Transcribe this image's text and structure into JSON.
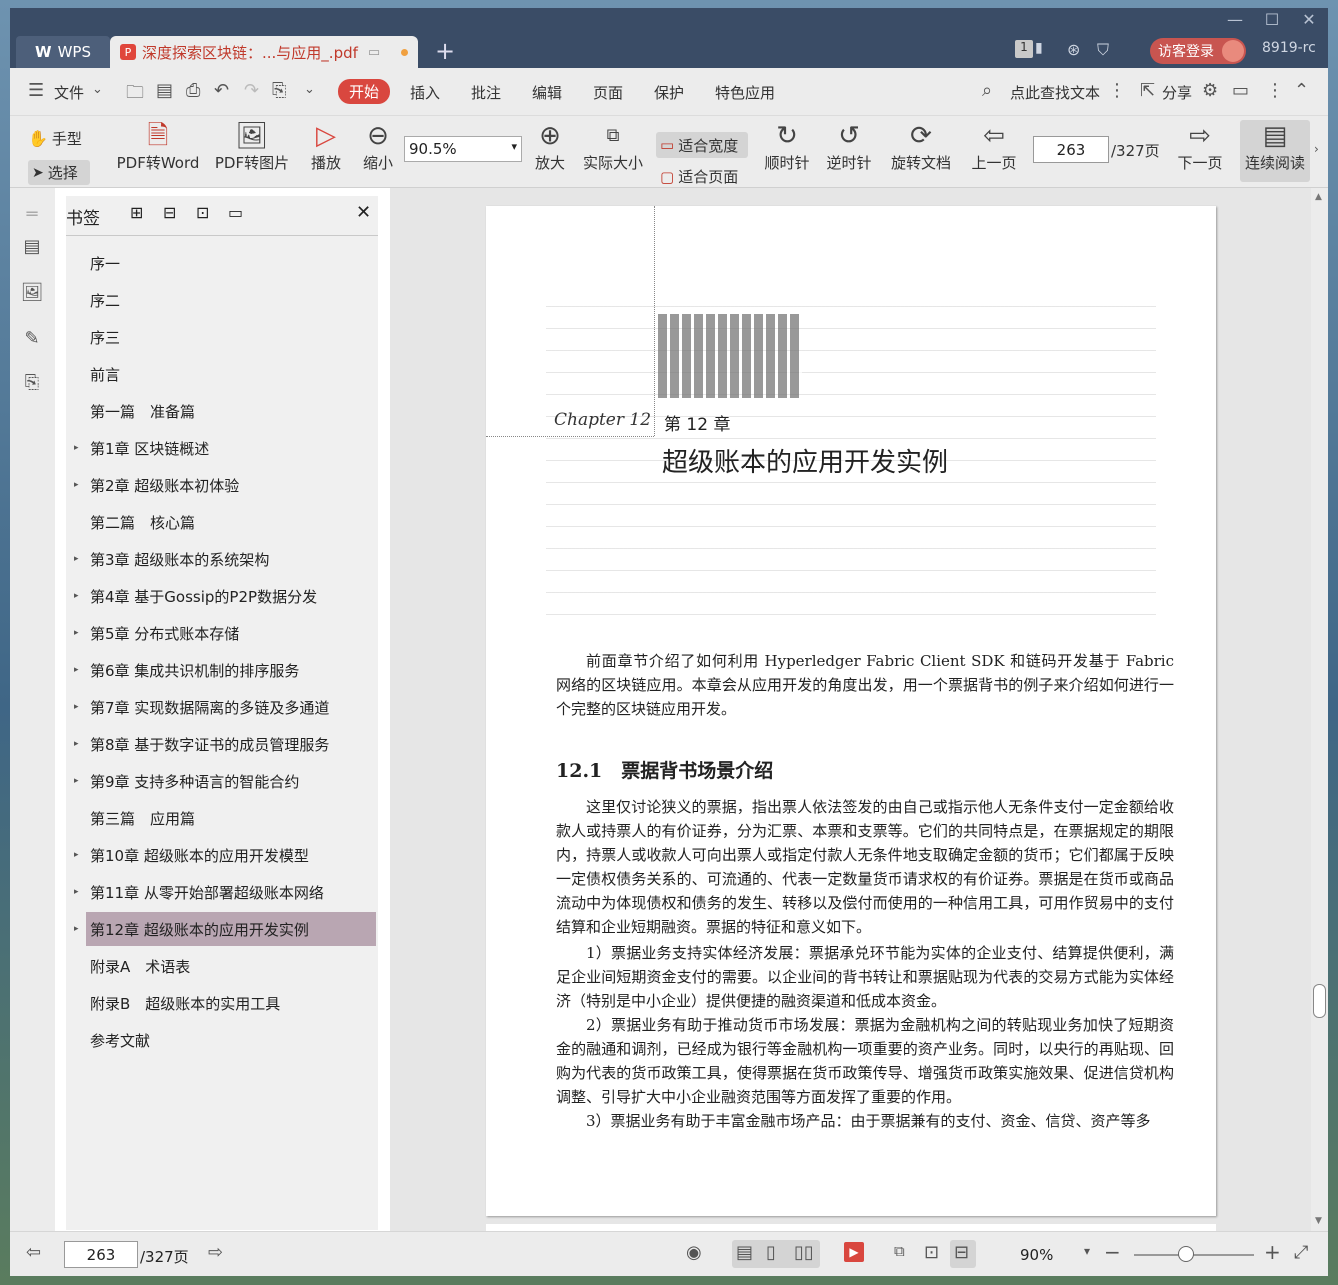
{
  "titlebar": {
    "app_tab": "WPS",
    "doc_tab": "深度探索区块链：...与应用_.pdf",
    "new_tab": "+",
    "count_badge": "1",
    "login": "访客登录",
    "user_id": "8919-rc"
  },
  "menu": {
    "file": "文件",
    "tabs": [
      "开始",
      "插入",
      "批注",
      "编辑",
      "页面",
      "保护",
      "特色应用"
    ],
    "search": "点此查找文本",
    "share": "分享"
  },
  "toolbar": {
    "hand": "手型",
    "select": "选择",
    "pdf_word": "PDF转Word",
    "pdf_image": "PDF转图片",
    "play": "播放",
    "zoom_out": "缩小",
    "zoom_value": "90.5%",
    "zoom_in": "放大",
    "actual_size": "实际大小",
    "fit_width": "适合宽度",
    "fit_page": "适合页面",
    "rotate_cw": "顺时针",
    "rotate_ccw": "逆时针",
    "rotate_doc": "旋转文档",
    "prev_page": "上一页",
    "page_current": "263",
    "page_total": "/327页",
    "next_page": "下一页",
    "continuous": "连续阅读"
  },
  "sidebar": {
    "title": "书签",
    "items": [
      {
        "label": "序一",
        "arrow": false
      },
      {
        "label": "序二",
        "arrow": false
      },
      {
        "label": "序三",
        "arrow": false
      },
      {
        "label": "前言",
        "arrow": false
      },
      {
        "label": "第一篇　准备篇",
        "arrow": false
      },
      {
        "label": "第1章 区块链概述",
        "arrow": true
      },
      {
        "label": "第2章 超级账本初体验",
        "arrow": true
      },
      {
        "label": "第二篇　核心篇",
        "arrow": false
      },
      {
        "label": "第3章 超级账本的系统架构",
        "arrow": true
      },
      {
        "label": "第4章 基于Gossip的P2P数据分发",
        "arrow": true
      },
      {
        "label": "第5章 分布式账本存储",
        "arrow": true
      },
      {
        "label": "第6章 集成共识机制的排序服务",
        "arrow": true
      },
      {
        "label": "第7章 实现数据隔离的多链及多通道",
        "arrow": true
      },
      {
        "label": "第8章 基于数字证书的成员管理服务",
        "arrow": true
      },
      {
        "label": "第9章 支持多种语言的智能合约",
        "arrow": true
      },
      {
        "label": "第三篇　应用篇",
        "arrow": false
      },
      {
        "label": "第10章 超级账本的应用开发模型",
        "arrow": true
      },
      {
        "label": "第11章 从零开始部署超级账本网络",
        "arrow": true
      },
      {
        "label": "第12章 超级账本的应用开发实例",
        "arrow": true,
        "active": true
      },
      {
        "label": "附录A　术语表",
        "arrow": false
      },
      {
        "label": "附录B　超级账本的实用工具",
        "arrow": false
      },
      {
        "label": "参考文献",
        "arrow": false
      }
    ]
  },
  "page": {
    "chapter_script": "Chapter 12",
    "chapter_no": "第 12 章",
    "chapter_title": "超级账本的应用开发实例",
    "intro": "前面章节介绍了如何利用 Hyperledger Fabric Client SDK 和链码开发基于 Fabric 网络的区块链应用。本章会从应用开发的角度出发，用一个票据背书的例子来介绍如何进行一个完整的区块链应用开发。",
    "section_title": "12.1　票据背书场景介绍",
    "p1": "这里仅讨论狭义的票据，指出票人依法签发的由自己或指示他人无条件支付一定金额给收款人或持票人的有价证券，分为汇票、本票和支票等。它们的共同特点是，在票据规定的期限内，持票人或收款人可向出票人或指定付款人无条件地支取确定金额的货币；它们都属于反映一定债权债务关系的、可流通的、代表一定数量货币请求权的有价证券。票据是在货币或商品流动中为体现债权和债务的发生、转移以及偿付而使用的一种信用工具，可用作贸易中的支付结算和企业短期融资。票据的特征和意义如下。",
    "p2": "1）票据业务支持实体经济发展：票据承兑环节能为实体的企业支付、结算提供便利，满足企业间短期资金支付的需要。以企业间的背书转让和票据贴现为代表的交易方式能为实体经济（特别是中小企业）提供便捷的融资渠道和低成本资金。",
    "p3": "2）票据业务有助于推动货币市场发展：票据为金融机构之间的转贴现业务加快了短期资金的融通和调剂，已经成为银行等金融机构一项重要的资产业务。同时，以央行的再贴现、回购为代表的货币政策工具，使得票据在货币政策传导、增强货币政策实施效果、促进信贷机构调整、引导扩大中小企业融资范围等方面发挥了重要的作用。",
    "p4": "3）票据业务有助于丰富金融市场产品：由于票据兼有的支付、资金、信贷、资产等多"
  },
  "statusbar": {
    "page_current": "263",
    "page_total": "/327页",
    "zoom": "90%"
  },
  "colors": {
    "accent": "#d9473f",
    "titlebar": "#3a4c66",
    "active_bookmark": "#b9a6b2"
  }
}
